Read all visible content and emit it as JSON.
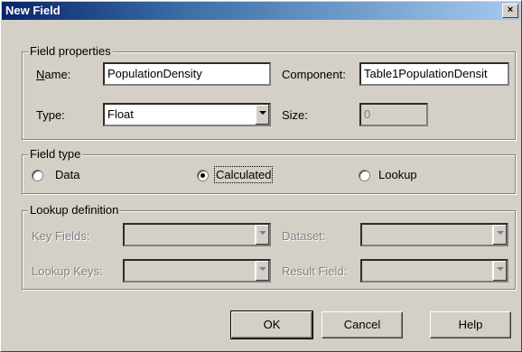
{
  "window": {
    "title": "New Field",
    "close_label": "×"
  },
  "field_properties": {
    "legend": "Field properties",
    "name_label": "Name:",
    "name_value": "PopulationDensity",
    "component_label": "Component:",
    "component_value": "Table1PopulationDensit",
    "type_label": "Type:",
    "type_value": "Float",
    "size_label": "Size:",
    "size_value": "0"
  },
  "field_type": {
    "legend": "Field type",
    "options": [
      {
        "label": "Data",
        "checked": false
      },
      {
        "label": "Calculated",
        "checked": true
      },
      {
        "label": "Lookup",
        "checked": false
      }
    ]
  },
  "lookup_definition": {
    "legend": "Lookup definition",
    "key_fields_label": "Key Fields:",
    "dataset_label": "Dataset:",
    "lookup_keys_label": "Lookup Keys:",
    "result_field_label": "Result Field:"
  },
  "buttons": {
    "ok": "OK",
    "cancel": "Cancel",
    "help": "Help"
  }
}
